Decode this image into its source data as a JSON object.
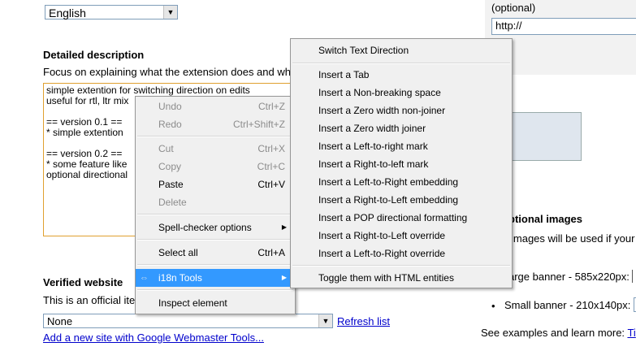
{
  "language_select": {
    "value": "English"
  },
  "description": {
    "heading": "Detailed description",
    "hint": "Focus on explaining what the extension does and wh",
    "text": "simple extention for switching direction on edits\nuseful for rtl, ltr mix\n\n== version 0.1 ==\n* simple extention \n\n== version 0.2 ==\n* some feature like\noptional directional"
  },
  "homepage": {
    "optional_label": "(optional)",
    "url_value": "http://"
  },
  "verified": {
    "heading": "Verified website",
    "hint": "This is an official ite",
    "select_value": "None",
    "refresh_link": "Refresh list",
    "add_link": "Add a new site with Google Webmaster Tools..."
  },
  "optional_images": {
    "heading": "ptional images",
    "hint": "images will be used if your",
    "large_banner": "arge banner - 585x220px:",
    "small_banner": "Small banner - 210x140px:",
    "examples": "See examples and learn more:",
    "examples_link": "Ti"
  },
  "context_menu": {
    "undo": {
      "label": "Undo",
      "shortcut": "Ctrl+Z"
    },
    "redo": {
      "label": "Redo",
      "shortcut": "Ctrl+Shift+Z"
    },
    "cut": {
      "label": "Cut",
      "shortcut": "Ctrl+X"
    },
    "copy": {
      "label": "Copy",
      "shortcut": "Ctrl+C"
    },
    "paste": {
      "label": "Paste",
      "shortcut": "Ctrl+V"
    },
    "delete": {
      "label": "Delete"
    },
    "spell": {
      "label": "Spell-checker options"
    },
    "select_all": {
      "label": "Select all",
      "shortcut": "Ctrl+A"
    },
    "i18n": {
      "label": "i18n Tools"
    },
    "inspect": {
      "label": "Inspect element"
    }
  },
  "submenu": {
    "items": [
      "Switch Text Direction",
      "Insert a Tab",
      "Insert a Non-breaking space",
      "Insert a Zero width non-joiner",
      "Insert a Zero width joiner",
      "Insert a Left-to-right mark",
      "Insert a Right-to-left mark",
      "Insert a Left-to-Right embedding",
      "Insert a Right-to-Left embedding",
      "Insert a POP directional formatting",
      "Insert a Right-to-Left override",
      "Insert a Left-to-Right override",
      "Toggle them with HTML entities"
    ]
  }
}
